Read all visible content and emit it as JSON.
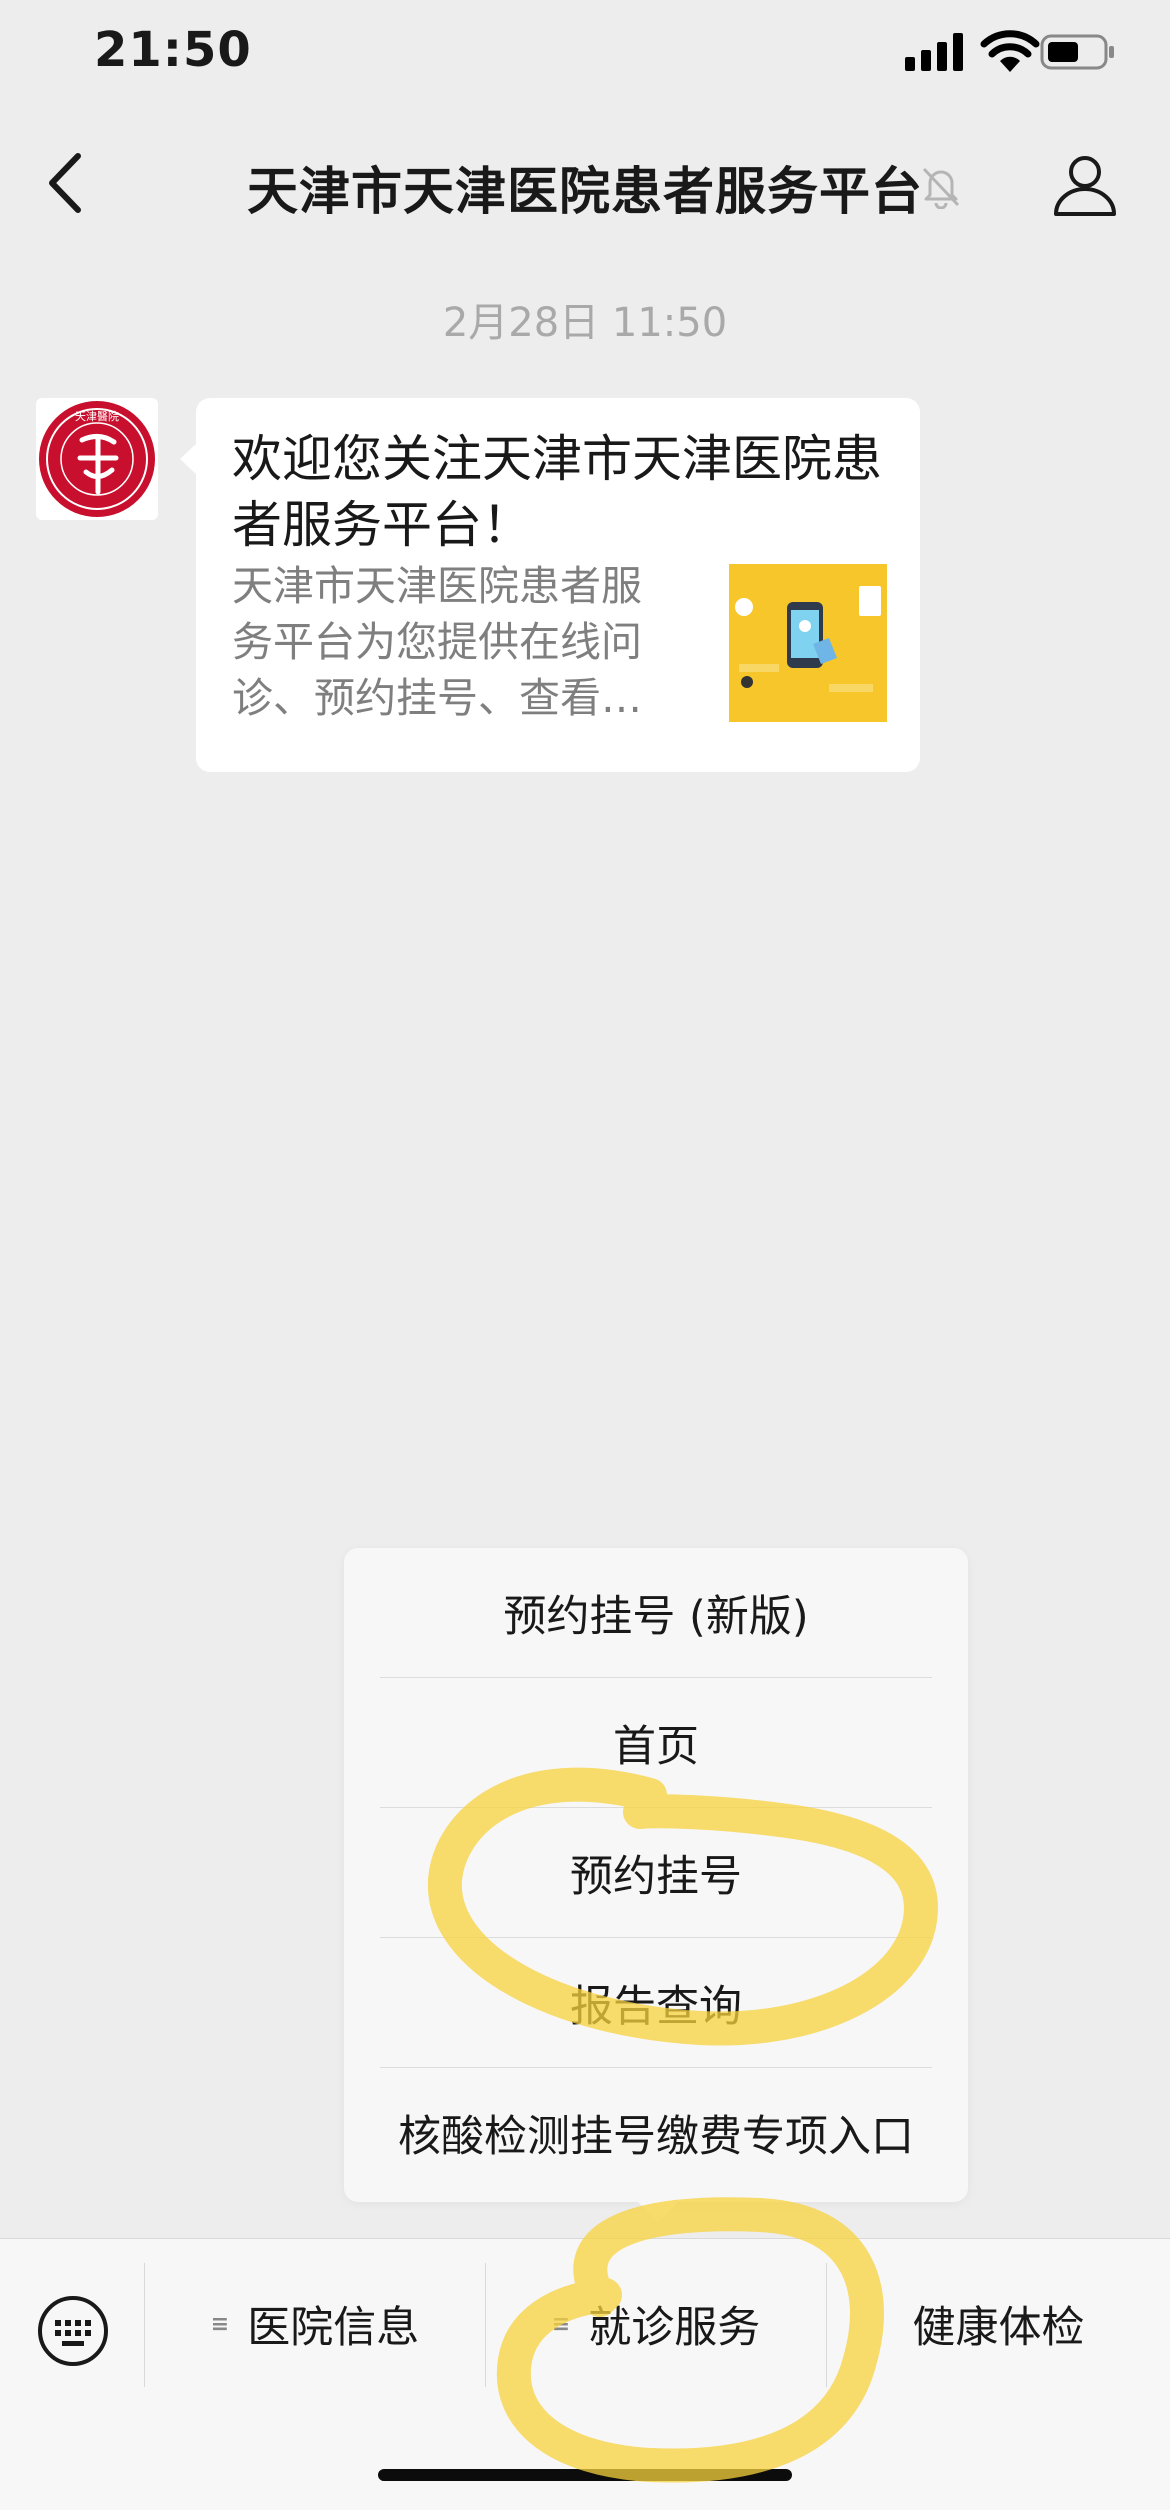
{
  "status_bar": {
    "time": "21:50"
  },
  "nav": {
    "title": "天津市天津医院患者服务平台"
  },
  "chat": {
    "timestamp": "2月28日 11:50",
    "avatar_text": "天津醫院",
    "message": {
      "title": "欢迎您关注天津市天津医院患者服务平台！",
      "description": "天津市天津医院患者服务平台为您提供在线问诊、预约挂号、查看…"
    }
  },
  "popup_menu": {
    "items": [
      "预约挂号 (新版)",
      "首页",
      "预约挂号",
      "报告查询",
      "核酸检测挂号缴费专项入口"
    ]
  },
  "bottom_menu": {
    "tabs": [
      "医院信息",
      "就诊服务",
      "健康体检"
    ]
  },
  "colors": {
    "background": "#ededed",
    "bubble": "#ffffff",
    "menu_bg": "#f7f7f7",
    "marker": "#f7d23c",
    "logo_red": "#c8102e"
  }
}
